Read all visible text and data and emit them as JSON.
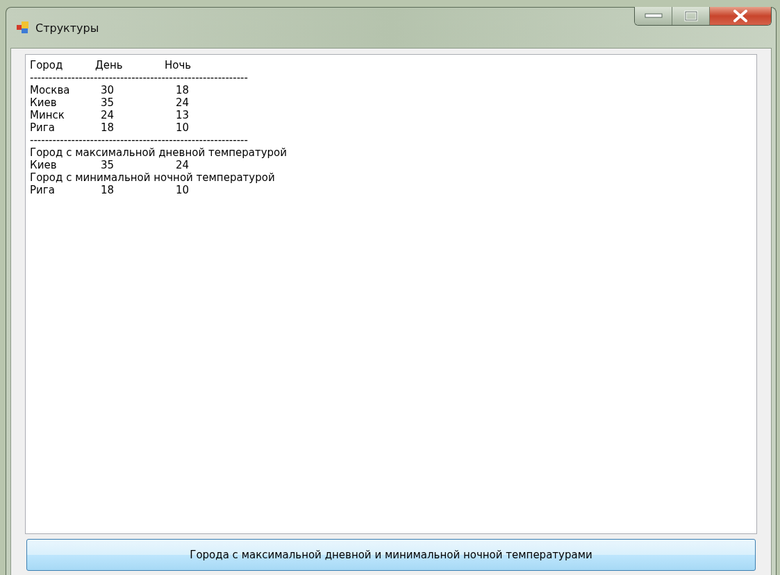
{
  "window": {
    "title": "Структуры"
  },
  "output": {
    "lines": [
      {
        "kind": "header",
        "cells": [
          "Город",
          "День",
          "Ночь"
        ]
      },
      {
        "kind": "text",
        "text": "----------------------------------------------------------"
      },
      {
        "kind": "row",
        "cells": [
          "Москва",
          "30",
          "18"
        ]
      },
      {
        "kind": "row",
        "cells": [
          "Киев",
          "35",
          "24"
        ]
      },
      {
        "kind": "row",
        "cells": [
          "Минск",
          "24",
          "13"
        ]
      },
      {
        "kind": "row",
        "cells": [
          "Рига",
          "18",
          "10"
        ]
      },
      {
        "kind": "text",
        "text": "----------------------------------------------------------"
      },
      {
        "kind": "text",
        "text": "Город с максимальной дневной температурой"
      },
      {
        "kind": "row",
        "cells": [
          "Киев",
          "35",
          "24"
        ]
      },
      {
        "kind": "text",
        "text": "Город с минимальной ночной температурой"
      },
      {
        "kind": "row",
        "cells": [
          "Рига",
          "18",
          "10"
        ]
      }
    ]
  },
  "button": {
    "label": "Города с максимальной дневной и минимальной ночной температурами"
  }
}
